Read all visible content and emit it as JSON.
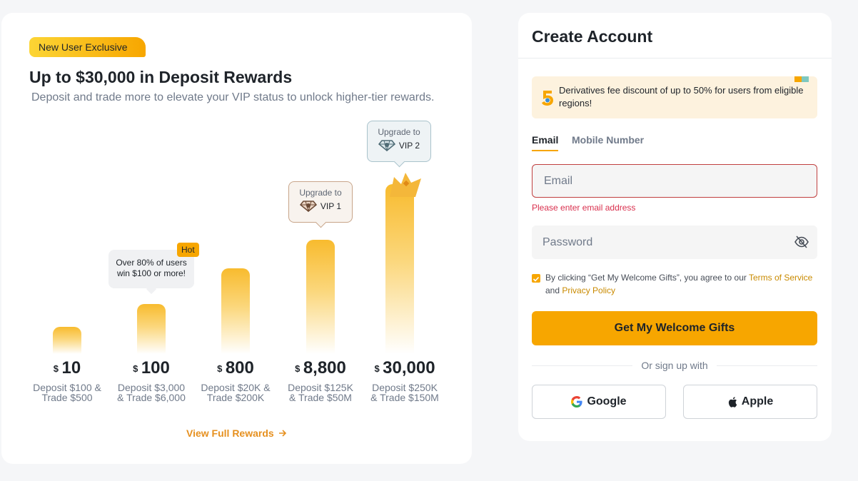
{
  "promo": {
    "badge": "New User Exclusive",
    "title": "Up to $30,000 in Deposit Rewards",
    "subtitle": "Deposit and trade more to elevate your VIP status to unlock higher-tier rewards.",
    "hot_badge": "Hot",
    "hot_tip": [
      "Over 80% of users",
      "win $100 or more!"
    ],
    "upgrade_label": "Upgrade to",
    "tiers": [
      {
        "currency": "$",
        "amount": "10",
        "req": [
          "Deposit $100 &",
          "Trade $500"
        ]
      },
      {
        "currency": "$",
        "amount": "100",
        "req": [
          "Deposit $3,000",
          "& Trade $6,000"
        ]
      },
      {
        "currency": "$",
        "amount": "800",
        "req": [
          "Deposit $20K &",
          "Trade $200K"
        ]
      },
      {
        "currency": "$",
        "amount": "8,800",
        "req": [
          "Deposit $125K",
          "& Trade $50M"
        ],
        "vip": "VIP 1"
      },
      {
        "currency": "$",
        "amount": "30,000",
        "req": [
          "Deposit $250K",
          "& Trade $150M"
        ],
        "vip": "VIP 2"
      }
    ],
    "view_link": "View Full Rewards"
  },
  "form": {
    "title": "Create Account",
    "notice": "Derivatives fee discount of up to 50% for users from eligible regions!",
    "tabs": [
      "Email",
      "Mobile Number"
    ],
    "email_placeholder": "Email",
    "email_error": "Please enter email address",
    "password_placeholder": "Password",
    "agree": {
      "prefix": "By clicking “Get My Welcome Gifts”, you agree to our ",
      "terms": "Terms of Service",
      "and": " and ",
      "privacy": "Privacy Policy"
    },
    "submit": "Get My Welcome Gifts",
    "or_text": "Or sign up with",
    "google": "Google",
    "apple": "Apple"
  },
  "colors": {
    "accent": "#f7a600",
    "link": "#e6901f",
    "error": "#d9304e"
  }
}
